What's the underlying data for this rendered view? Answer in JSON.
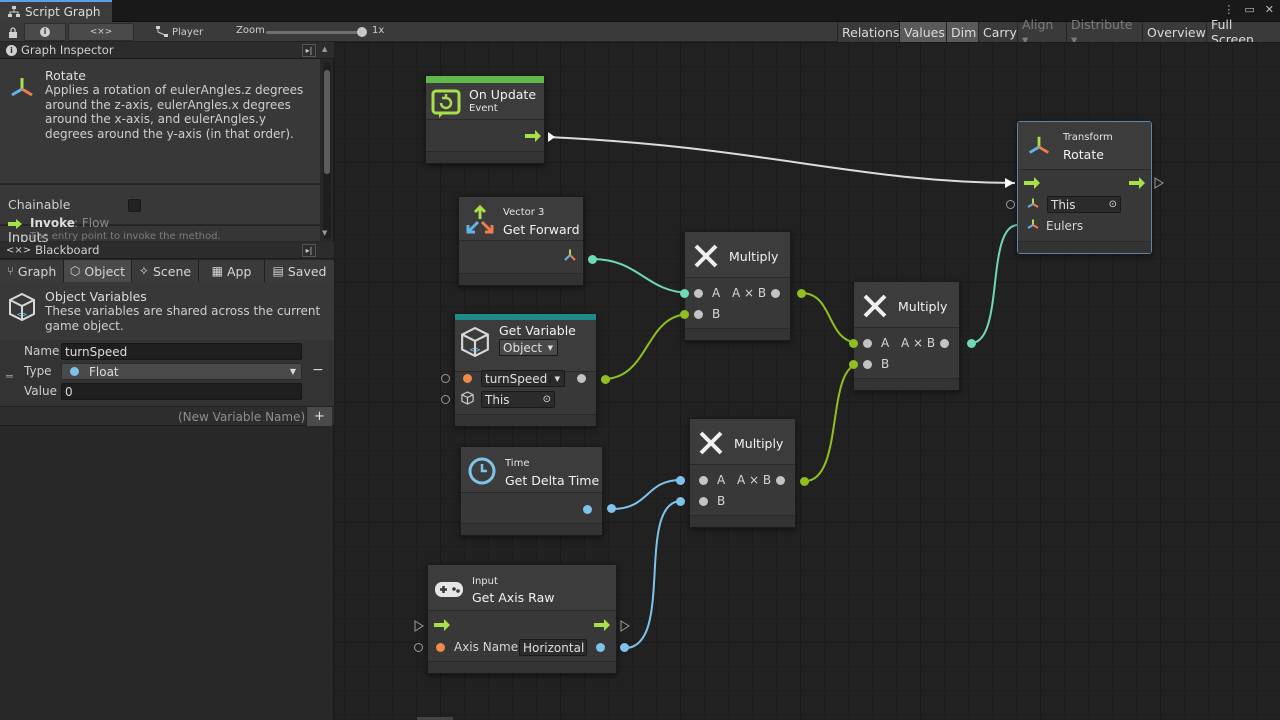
{
  "window": {
    "tab_title": "Script Graph"
  },
  "toolbar": {
    "player_label": "Player",
    "zoom_label": "Zoom",
    "zoom_value_label": "1x",
    "zoom_level": 1.0,
    "right_buttons": [
      "Relations",
      "Values",
      "Dim",
      "Carry",
      "Align ▾",
      "Distribute ▾",
      "Overview",
      "Full Screen"
    ]
  },
  "inspector": {
    "header": "Graph Inspector",
    "title": "Rotate",
    "description": "Applies a rotation of eulerAngles.z degrees around the z-axis, eulerAngles.x degrees around the x-axis, and eulerAngles.y degrees around the y-axis (in that order).",
    "chainable_label": "Chainable",
    "inputs_label": "Inputs",
    "invoke_name": "Invoke",
    "invoke_type": ": Flow",
    "invoke_desc": "The entry point to invoke the method."
  },
  "blackboard": {
    "header": "Blackboard",
    "tabs": [
      "Graph",
      "Object",
      "Scene",
      "App",
      "Saved"
    ],
    "title": "Object Variables",
    "description": "These variables are shared across the current game object.",
    "name_label": "Name",
    "name_value": "turnSpeed",
    "type_label": "Type",
    "type_value": "Float",
    "value_label": "Value",
    "value_value": "0",
    "new_var_placeholder": "(New Variable Name)"
  },
  "nodes": {
    "on_update": {
      "title": "On Update",
      "subtitle": "Event",
      "accent": "#5fb84a"
    },
    "rotate": {
      "subtitle": "Transform",
      "title": "Rotate",
      "this_value": "This",
      "eulers_label": "Eulers"
    },
    "get_forward": {
      "subtitle": "Vector 3",
      "title": "Get Forward"
    },
    "get_variable": {
      "title": "Get Variable",
      "kind": "Object",
      "var": "turnSpeed",
      "target": "This",
      "accent": "#1f8a8a"
    },
    "multiply_1": {
      "title": "Multiply",
      "a": "A",
      "b": "B",
      "out": "A × B"
    },
    "multiply_2": {
      "title": "Multiply",
      "a": "A",
      "b": "B",
      "out": "A × B"
    },
    "multiply_3": {
      "title": "Multiply",
      "a": "A",
      "b": "B",
      "out": "A × B"
    },
    "delta_time": {
      "subtitle": "Time",
      "title": "Get Delta Time"
    },
    "axis_raw": {
      "subtitle": "Input",
      "title": "Get Axis Raw",
      "axis_label": "Axis Name",
      "axis_value": "Horizontal"
    }
  },
  "colors": {
    "flow": "#a8e04a",
    "vector": "#6fd8b9",
    "float": "#7fc3ea",
    "generic": "#8fc020",
    "selection": "#5a86b0"
  }
}
